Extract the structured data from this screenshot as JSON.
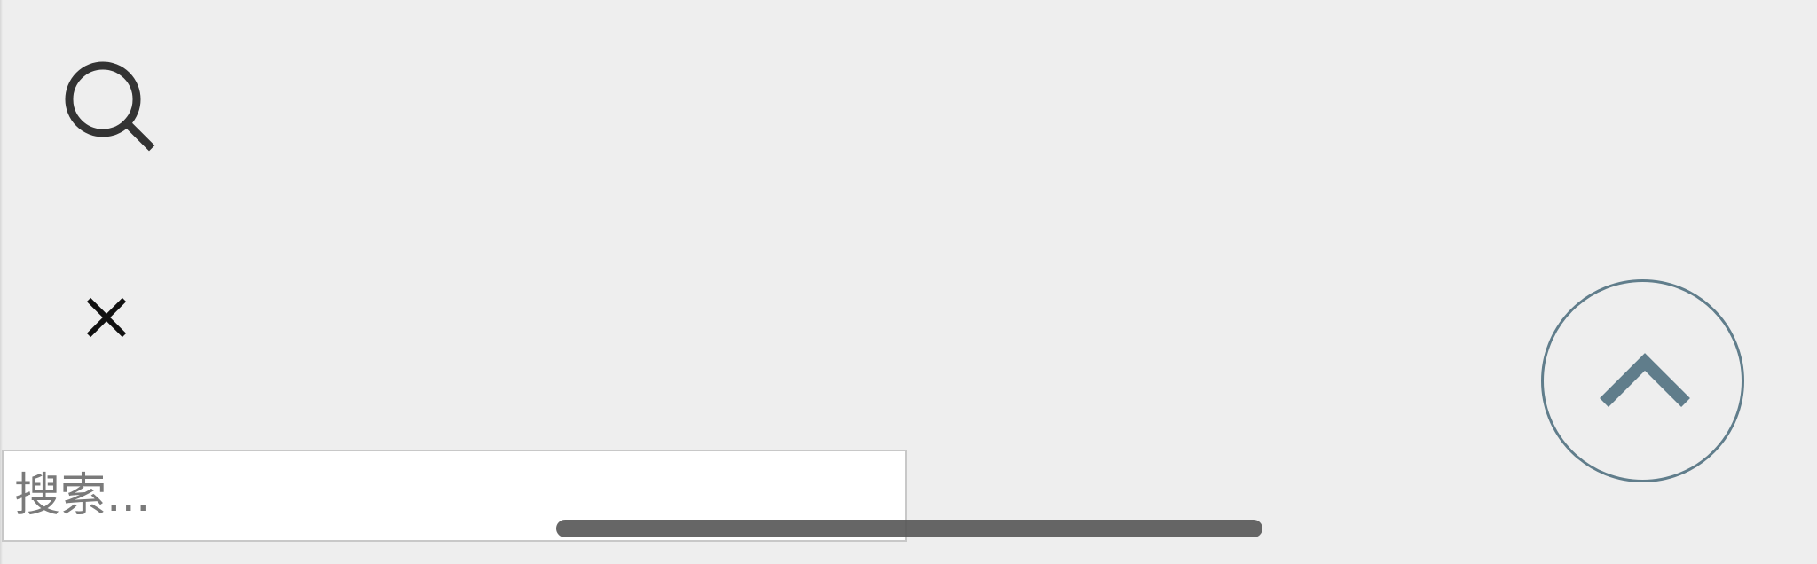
{
  "search": {
    "icon": "search-icon",
    "placeholder": "搜索..."
  },
  "close": {
    "icon": "close-icon"
  },
  "back_to_top": {
    "icon": "chevron-up-icon",
    "color": "#607d8b"
  },
  "colors": {
    "background": "#eeeeee",
    "input_background": "#ffffff",
    "input_border": "#c8c8c8",
    "icon_dark": "#333333",
    "accent": "#607d8b",
    "scroll_indicator": "#555555"
  }
}
